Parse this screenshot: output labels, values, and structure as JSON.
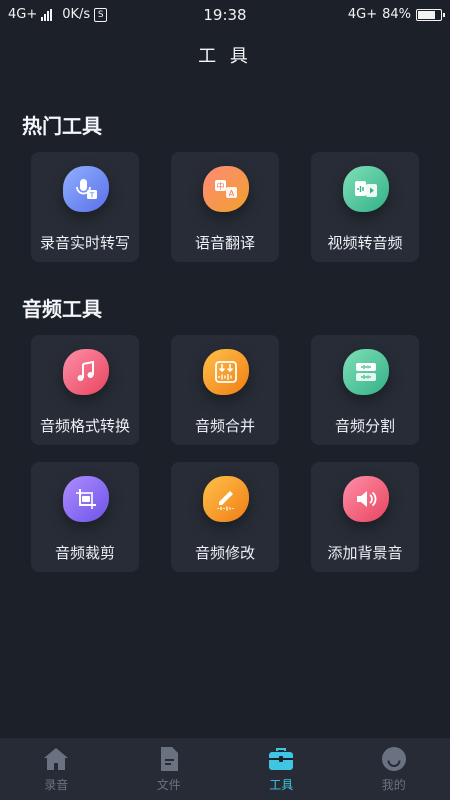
{
  "status_bar": {
    "network_left": "4G+",
    "speed": "0K/s",
    "s_badge": "S",
    "time": "19:38",
    "network_right": "4G+",
    "battery_percent": "84%",
    "battery_level": 0.84
  },
  "header": {
    "title": "工 具"
  },
  "hot_tools": {
    "title": "热门工具",
    "items": [
      {
        "label": "录音实时转写",
        "icon": "mic-transcribe-icon",
        "color": "#6f8cf0"
      },
      {
        "label": "语音翻译",
        "icon": "translate-icon",
        "color": "#f07a5a"
      },
      {
        "label": "视频转音频",
        "icon": "video-to-audio-icon",
        "color": "#4ec39a"
      }
    ]
  },
  "audio_tools": {
    "title": "音频工具",
    "items": [
      {
        "label": "音频格式转换",
        "icon": "music-note-icon",
        "color": "#f0607e"
      },
      {
        "label": "音频合并",
        "icon": "merge-icon",
        "color": "#f5a52a"
      },
      {
        "label": "音频分割",
        "icon": "split-icon",
        "color": "#4ec39a"
      },
      {
        "label": "音频裁剪",
        "icon": "crop-icon",
        "color": "#8a6cf0"
      },
      {
        "label": "音频修改",
        "icon": "edit-audio-icon",
        "color": "#f59a2a"
      },
      {
        "label": "添加背景音",
        "icon": "speaker-icon",
        "color": "#f0607e"
      }
    ]
  },
  "tabbar": {
    "tabs": [
      {
        "label": "录音",
        "icon": "home-icon",
        "active": false
      },
      {
        "label": "文件",
        "icon": "file-icon",
        "active": false
      },
      {
        "label": "工具",
        "icon": "toolbox-icon",
        "active": true
      },
      {
        "label": "我的",
        "icon": "profile-face-icon",
        "active": false
      }
    ],
    "active_color": "#3fc6e3",
    "inactive_color": "#6a7180"
  }
}
